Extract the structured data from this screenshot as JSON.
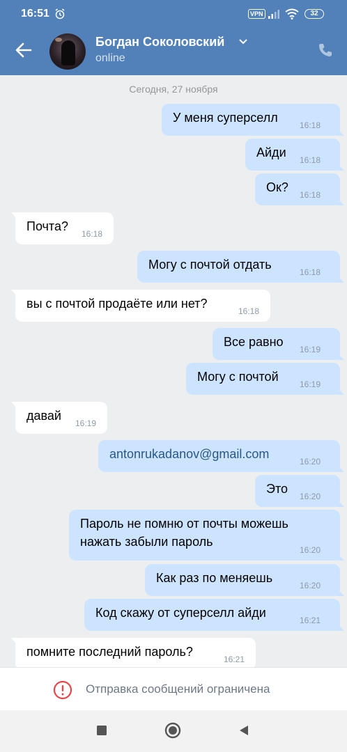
{
  "status_bar": {
    "time": "16:51",
    "vpn": "VPN",
    "battery": "32"
  },
  "header": {
    "contact_name": "Богдан Соколовский",
    "presence": "online"
  },
  "chat": {
    "date_separator": "Сегодня, 27 ноября",
    "messages": [
      {
        "dir": "out",
        "text": "У меня суперселл",
        "time": "16:18"
      },
      {
        "dir": "out",
        "text": "Айди",
        "time": "16:18"
      },
      {
        "dir": "out",
        "text": "Ок?",
        "time": "16:18"
      },
      {
        "dir": "in",
        "text": "Почта?",
        "time": "16:18"
      },
      {
        "dir": "out",
        "text": "Могу с почтой отдать",
        "time": "16:18"
      },
      {
        "dir": "in",
        "text": "вы с почтой продаёте или нет?",
        "time": "16:18"
      },
      {
        "dir": "out",
        "text": "Все равно",
        "time": "16:19"
      },
      {
        "dir": "out",
        "text": "Могу с почтой",
        "time": "16:19"
      },
      {
        "dir": "in",
        "text": "давай",
        "time": "16:19"
      },
      {
        "dir": "out",
        "text": "antonrukadanov@gmail.com",
        "time": "16:20"
      },
      {
        "dir": "out",
        "text": "Это",
        "time": "16:20"
      },
      {
        "dir": "out",
        "text": "Пароль не помню от почты можешь\nнажать забыли пароль",
        "time": "16:20"
      },
      {
        "dir": "out",
        "text": "Как раз по меняешь",
        "time": "16:20"
      },
      {
        "dir": "out",
        "text": "Код скажу от суперселл айди",
        "time": "16:21"
      },
      {
        "dir": "in",
        "text": "помните последний пароль?",
        "time": "16:21"
      }
    ]
  },
  "restriction": {
    "text": "Отправка сообщений ограничена"
  },
  "colors": {
    "header_bg": "#5181b8",
    "outgoing_bubble": "#cce4ff",
    "incoming_bubble": "#ffffff",
    "chat_bg": "#edeef0",
    "warning": "#e64646"
  },
  "icons": {
    "back": "arrow-left-icon",
    "phone": "phone-icon",
    "warning": "exclamation-circle-icon",
    "nav_recent": "square-icon",
    "nav_home": "circle-icon",
    "nav_back": "triangle-icon"
  }
}
